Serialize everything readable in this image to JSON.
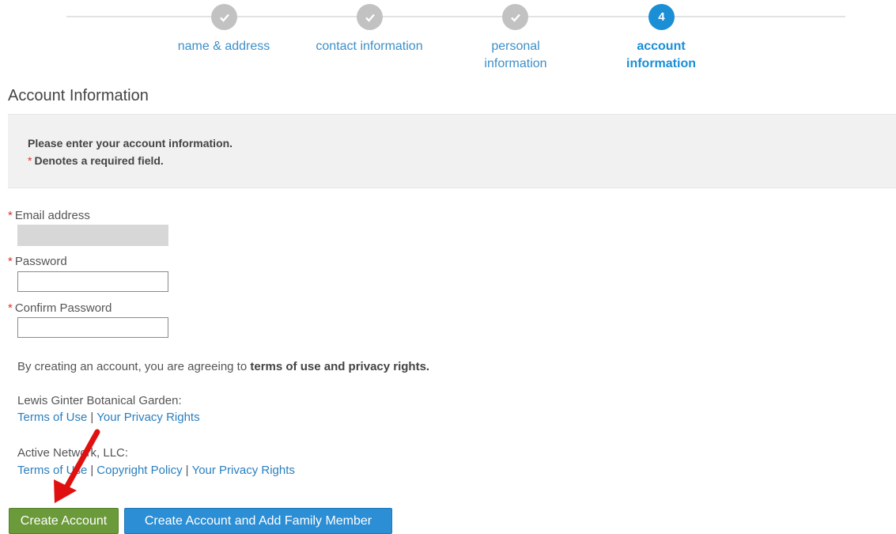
{
  "steps": [
    {
      "label": "name & address",
      "state": "done"
    },
    {
      "label": "contact information",
      "state": "done"
    },
    {
      "label": "personal\ninformation",
      "state": "done"
    },
    {
      "label": "account\ninformation",
      "state": "active",
      "number": "4"
    }
  ],
  "section_title": "Account Information",
  "notice": {
    "main": "Please enter your account information.",
    "required_star": "*",
    "required_text": "Denotes a required field."
  },
  "form": {
    "email_label": "Email address",
    "email_value": "",
    "password_label": "Password",
    "password_value": "",
    "confirm_label": "Confirm Password",
    "confirm_value": "",
    "star": "*"
  },
  "legal": {
    "agree_prefix": "By creating an account, you are agreeing to ",
    "agree_bold": "terms of use and privacy rights.",
    "org1": {
      "name": "Lewis Ginter Botanical Garden:",
      "links": [
        "Terms of Use",
        "Your Privacy Rights"
      ]
    },
    "org2": {
      "name": "Active Network, LLC:",
      "links": [
        "Terms of Use",
        "Copyright Policy",
        "Your Privacy Rights"
      ]
    },
    "separator": "|"
  },
  "buttons": {
    "create": "Create Account",
    "create_add_family": "Create Account and Add Family Member"
  },
  "colors": {
    "accent_blue": "#1a8fd6",
    "step_done": "#c2c2c2",
    "link": "#2a7fbf",
    "green_button": "#6b9a3a",
    "blue_button": "#2c8ed4",
    "required_star": "#d9342b",
    "arrow": "#e01010"
  },
  "icons": {
    "done_step": "checkmark-icon",
    "annotation": "red-arrow-icon"
  }
}
